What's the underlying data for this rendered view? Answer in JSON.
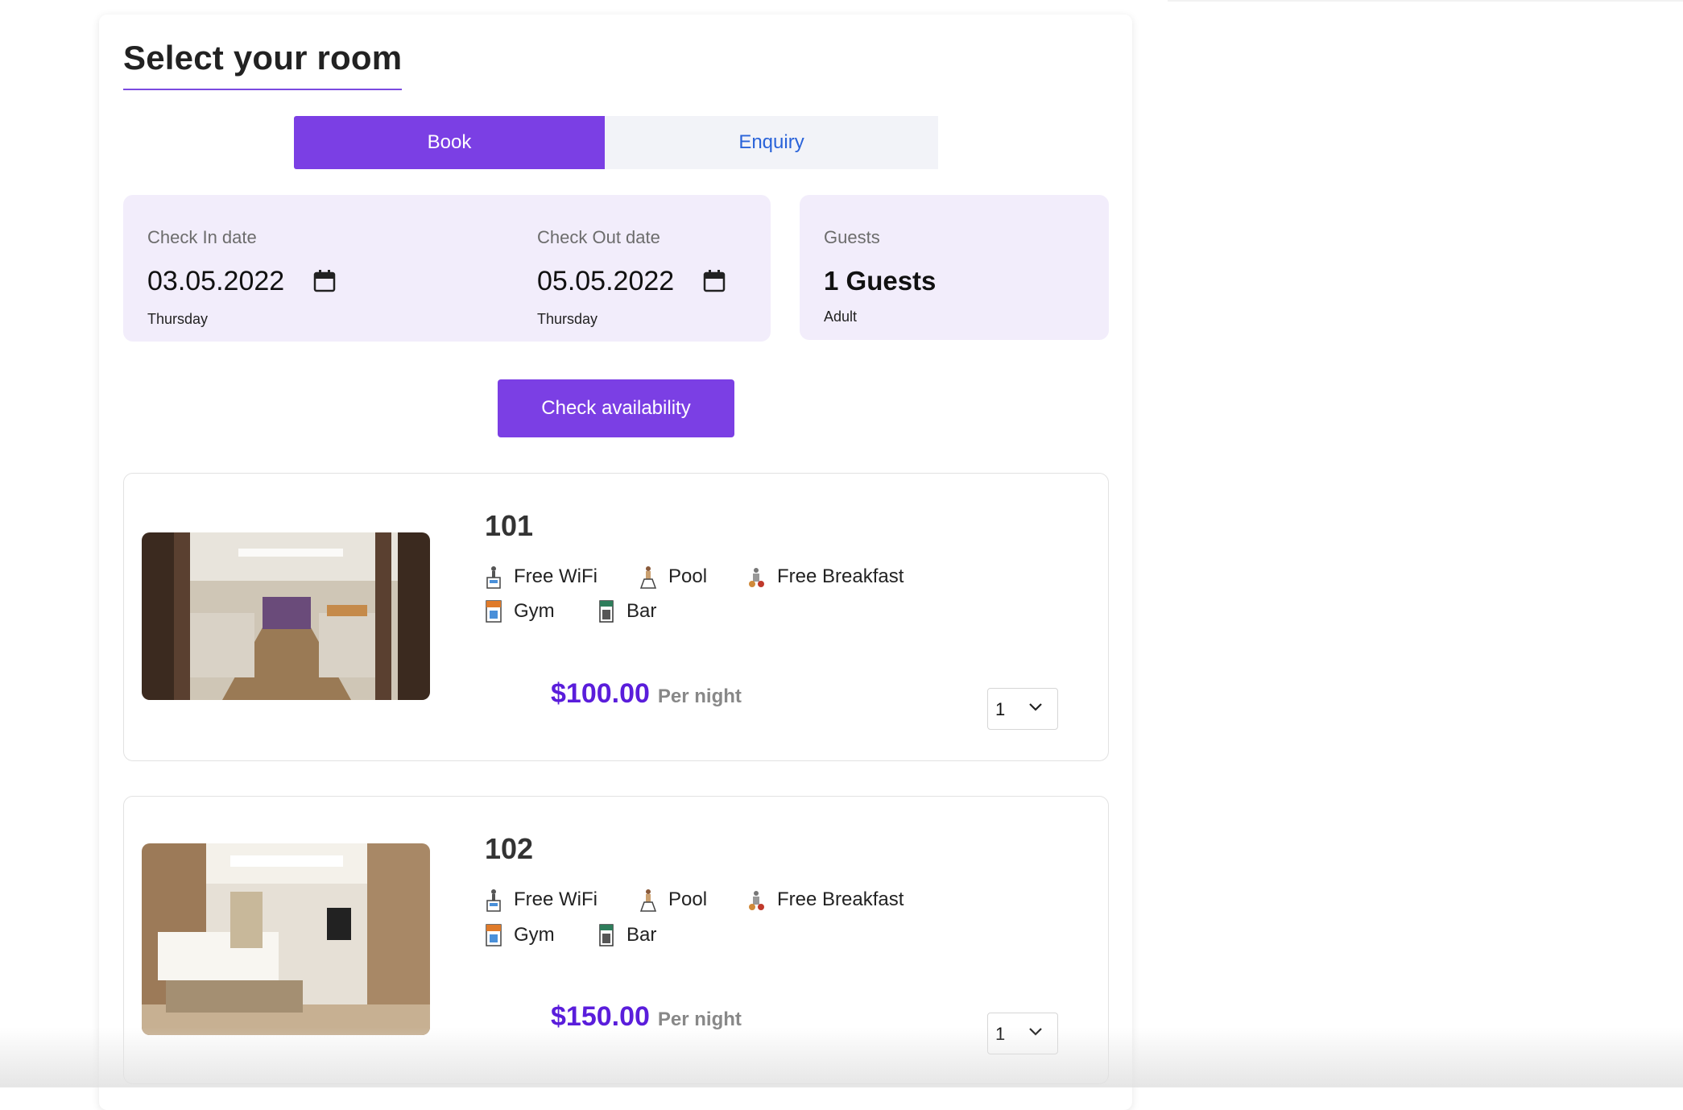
{
  "page": {
    "title": "Select your room"
  },
  "tabs": [
    {
      "label": "Book",
      "active": true
    },
    {
      "label": "Enquiry",
      "active": false
    }
  ],
  "booking": {
    "check_in": {
      "label": "Check In date",
      "value": "03.05.2022",
      "day": "Thursday"
    },
    "check_out": {
      "label": "Check Out date",
      "value": "05.05.2022",
      "day": "Thursday"
    },
    "guests": {
      "label": "Guests",
      "value": "1 Guests",
      "sub": "Adult"
    }
  },
  "actions": {
    "check_availability": "Check availability"
  },
  "rooms": [
    {
      "name": "101",
      "amenities": [
        "Free WiFi",
        "Pool",
        "Free Breakfast",
        "Gym",
        "Bar"
      ],
      "price": "$100.00",
      "price_unit": "Per night",
      "quantity": "1",
      "image": "breakfast-buffet-room-photo"
    },
    {
      "name": "102",
      "amenities": [
        "Free WiFi",
        "Pool",
        "Free Breakfast",
        "Gym",
        "Bar"
      ],
      "price": "$150.00",
      "price_unit": "Per night",
      "quantity": "1",
      "image": "hotel-bedroom-photo"
    }
  ],
  "colors": {
    "accent": "#7b3fe4",
    "price": "#5a1ddb",
    "field_bg": "#f2edfb",
    "tab_inactive_bg": "#f2f3f8",
    "tab_inactive_text": "#2a63d9"
  }
}
